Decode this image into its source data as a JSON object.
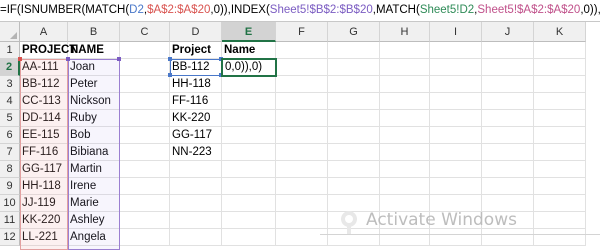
{
  "formula_bar": {
    "segments": [
      {
        "text": "=IF(ISNUMBER(MATCH(",
        "color": "#000000"
      },
      {
        "text": "D2",
        "color": "#4a78c9"
      },
      {
        "text": ",",
        "color": "#000000"
      },
      {
        "text": "$A$2:$A$20",
        "color": "#d9534f"
      },
      {
        "text": ",0)),INDEX(",
        "color": "#000000"
      },
      {
        "text": "Sheet5!$B$2:$B$20",
        "color": "#7b5cc2"
      },
      {
        "text": ",MATCH(",
        "color": "#000000"
      },
      {
        "text": "Sheet5!D2",
        "color": "#2e8b57"
      },
      {
        "text": ",",
        "color": "#000000"
      },
      {
        "text": "Sheet5!$A$2:$A$20",
        "color": "#c0508a"
      },
      {
        "text": ",0)),0)",
        "color": "#000000"
      }
    ]
  },
  "columns": [
    "A",
    "B",
    "C",
    "D",
    "E",
    "F",
    "G",
    "H",
    "I",
    "J",
    "K"
  ],
  "active_column": "E",
  "rows": [
    "1",
    "2",
    "3",
    "4",
    "5",
    "6",
    "7",
    "8",
    "9",
    "10",
    "11",
    "12"
  ],
  "active_row": "2",
  "headers": {
    "a1": "PROJECT",
    "b1": "NAME",
    "d1": "Project",
    "e1": "Name"
  },
  "table_a": [
    {
      "project": "AA-111",
      "name": "Joan"
    },
    {
      "project": "BB-112",
      "name": "Peter"
    },
    {
      "project": "CC-113",
      "name": "Nickson"
    },
    {
      "project": "DD-114",
      "name": "Ruby"
    },
    {
      "project": "EE-115",
      "name": "Bob"
    },
    {
      "project": "FF-116",
      "name": "Bibiana"
    },
    {
      "project": "GG-117",
      "name": "Martin"
    },
    {
      "project": "HH-118",
      "name": "Irene"
    },
    {
      "project": "JJ-119",
      "name": "Marie"
    },
    {
      "project": "KK-220",
      "name": "Ashley"
    },
    {
      "project": "LL-221",
      "name": "Angela"
    }
  ],
  "lookup_projects": [
    "BB-112",
    "HH-118",
    "FF-116",
    "KK-220",
    "GG-117",
    "NN-223"
  ],
  "editing_cell_text": "0,0)),0)",
  "watermark_text": "Activate Windows"
}
